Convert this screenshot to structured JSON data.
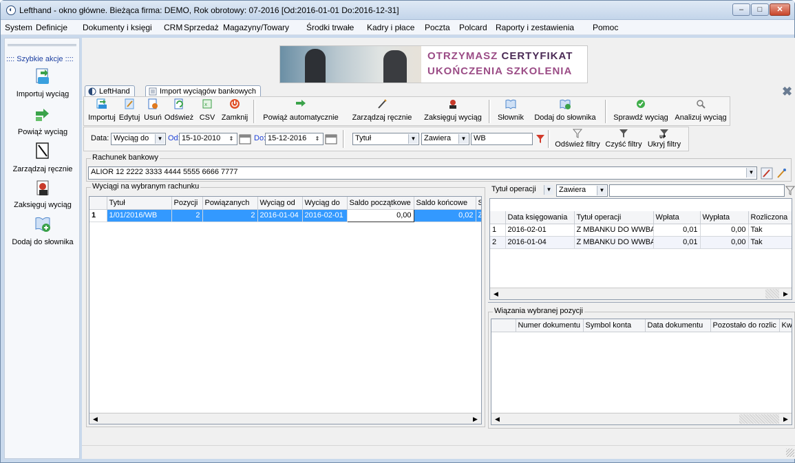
{
  "window": {
    "title": "Lefthand - okno główne. Bieżąca firma: DEMO, Rok obrotowy: 07-2016 [Od:2016-01-01 Do:2016-12-31]",
    "minimize": "‒",
    "maximize": "□",
    "close": "✕"
  },
  "menu": [
    "System",
    "Definicje",
    "Dokumenty i księgi",
    "CRM",
    "Sprzedaż",
    "Magazyny/Towary",
    "Środki trwałe",
    "Kadry i płace",
    "Poczta",
    "Polcard",
    "Raporty i zestawienia",
    "Pomoc"
  ],
  "quick_actions": {
    "header": ":::: Szybkie akcje ::::",
    "items": [
      "Importuj wyciąg",
      "Powiąż wyciąg",
      "Zarządzaj ręcznie",
      "Zaksięguj wyciąg",
      "Dodaj do słownika"
    ]
  },
  "banner": {
    "line1_a": "OTRZYMASZ",
    "line1_b": "CERTYFIKAT",
    "line2": "UKOŃCZENIA SZKOLENIA"
  },
  "tabs": [
    "LeftHand",
    "Import wyciągów bankowych"
  ],
  "toolbar": {
    "buttons": [
      "Importuj",
      "Edytuj",
      "Usuń",
      "Odśwież",
      "CSV",
      "Zamknij",
      "Powiąż automatycznie",
      "Zarządzaj ręcznie",
      "Zaksięguj wyciąg",
      "Słownik",
      "Dodaj do słownika",
      "Sprawdź wyciąg",
      "Analizuj wyciąg"
    ],
    "colors": {
      "import": "#2f8fd8",
      "edit": "#5a9be0",
      "delete": "#3b74c9",
      "refresh": "#3aa14a",
      "csv": "#3a9e45",
      "close": "#e05028",
      "link": "#3aa34a",
      "manual": "#444444",
      "post": "#c83a2a",
      "dict": "#4d86cc",
      "dict_add": "#4d86cc",
      "check": "#3fae4a",
      "analyze": "#7a7a7a"
    }
  },
  "filters": {
    "data_label": "Data:",
    "data_value": "Wyciąg do",
    "od_label": "Od:",
    "od_value": "15-10-2010",
    "do_label": "Do:",
    "do_value": "15-12-2016",
    "field": "Tytuł",
    "condition": "Zawiera",
    "text": "WB",
    "buttons": [
      "Odśwież filtry",
      "Czyść filtry",
      "Ukryj filtry"
    ]
  },
  "account": {
    "group_title": "Rachunek bankowy",
    "value": "ALIOR  12 2222 3333 4444 5555 6666 7777"
  },
  "statements": {
    "group_title": "Wyciągi na wybranym rachunku",
    "columns": [
      "Tytuł",
      "Pozycji",
      "Powiązanych",
      "Wyciąg od",
      "Wyciąg do",
      "Saldo początkowe",
      "Saldo końcowe",
      "Sta"
    ],
    "rows": [
      {
        "n": "1",
        "title": "1/01/2016/WB",
        "pos": "2",
        "linked": "2",
        "from": "2016-01-04",
        "to": "2016-02-01",
        "open": "0,00",
        "close": "0,02",
        "status": "Zak"
      }
    ]
  },
  "operations": {
    "filter_field": "Tytuł operacji",
    "filter_cond": "Zawiera",
    "columns": [
      "Data księgowania",
      "Tytuł operacji",
      "Wpłata",
      "Wypłata",
      "Rozliczona"
    ],
    "rows": [
      {
        "n": "1",
        "date": "2016-02-01",
        "title": "Z MBANKU DO WWBANK",
        "in": "0,01",
        "out": "0,00",
        "settled": "Tak"
      },
      {
        "n": "2",
        "date": "2016-01-04",
        "title": "Z MBANKU DO WWBANK",
        "in": "0,01",
        "out": "0,00",
        "settled": "Tak"
      }
    ]
  },
  "links": {
    "group_title": "Wiązania wybranej pozycji",
    "columns": [
      "Numer dokumentu",
      "Symbol konta",
      "Data dokumentu",
      "Pozostało do rozlic",
      "Kw"
    ]
  }
}
